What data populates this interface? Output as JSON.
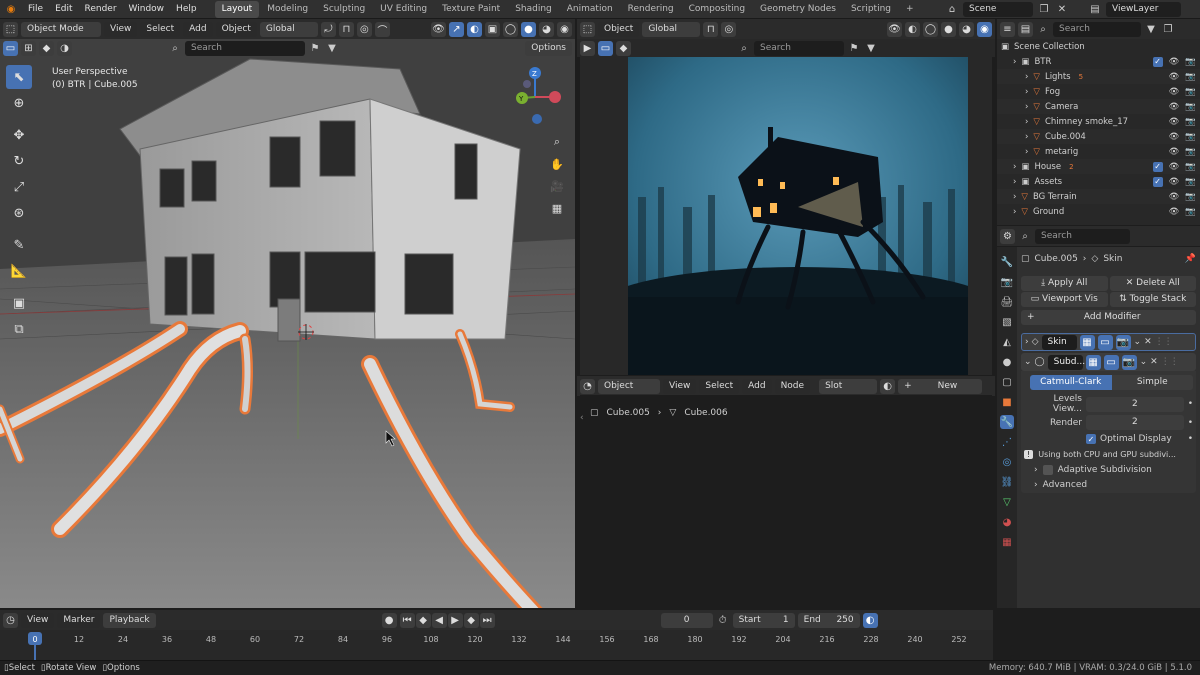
{
  "top_menu": [
    "File",
    "Edit",
    "Render",
    "Window",
    "Help"
  ],
  "workspaces": [
    "Layout",
    "Modeling",
    "Sculpting",
    "UV Editing",
    "Texture Paint",
    "Shading",
    "Animation",
    "Rendering",
    "Compositing",
    "Geometry Nodes",
    "Scripting"
  ],
  "workspace_add": "+",
  "scene": "Scene",
  "view_layer": "ViewLayer",
  "viewport": {
    "mode": "Object Mode",
    "menus": [
      "View",
      "Select",
      "Add",
      "Object"
    ],
    "orientation": "Global",
    "search_placeholder": "Search",
    "options": "Options",
    "perspective_label": "User Perspective",
    "object_info": "(0) BTR | Cube.005",
    "gizmo": {
      "z": "Z",
      "y": "Y",
      "x": "X"
    }
  },
  "render_view": {
    "header_label": "Object",
    "orientation": "Global",
    "search_placeholder": "Search"
  },
  "node_editor": {
    "type": "Object",
    "menus": [
      "View",
      "Select",
      "Add",
      "Node"
    ],
    "slot": "Slot",
    "new_label": "New",
    "breadcrumb": [
      "Cube.005",
      "Cube.006"
    ]
  },
  "outliner": {
    "search_placeholder": "Search",
    "root": "Scene Collection",
    "rows": [
      {
        "name": "BTR",
        "indent": 1,
        "collection": true
      },
      {
        "name": "Lights",
        "indent": 2,
        "badge": "5"
      },
      {
        "name": "Fog",
        "indent": 2
      },
      {
        "name": "Camera",
        "indent": 2
      },
      {
        "name": "Chimney smoke_17",
        "indent": 2
      },
      {
        "name": "Cube.004",
        "indent": 2
      },
      {
        "name": "metarig",
        "indent": 2
      },
      {
        "name": "House",
        "indent": 1,
        "collection": true,
        "badge": "2"
      },
      {
        "name": "Assets",
        "indent": 1,
        "collection": true
      },
      {
        "name": "BG Terrain",
        "indent": 1
      },
      {
        "name": "Ground",
        "indent": 1
      }
    ]
  },
  "properties": {
    "search_placeholder": "Search",
    "object": "Cube.005",
    "modifier_ctx": "Skin",
    "apply_all": "Apply All",
    "delete_all": "Delete All",
    "viewport_vis": "Viewport Vis",
    "toggle_stack": "Toggle Stack",
    "add_modifier": "Add Modifier",
    "modifiers": [
      "Skin",
      "Subd..."
    ],
    "subdiv_types": [
      "Catmull-Clark",
      "Simple"
    ],
    "levels_label": "Levels View...",
    "levels_value": "2",
    "render_label": "Render",
    "render_value": "2",
    "optimal_display": "Optimal Display",
    "info_text": "Using both CPU and GPU subdivi...",
    "adaptive": "Adaptive Subdivision",
    "advanced": "Advanced"
  },
  "timeline": {
    "menus": [
      "View",
      "Marker",
      "Playback"
    ],
    "current_frame": "0",
    "start_label": "Start",
    "start": "1",
    "end_label": "End",
    "end": "250",
    "ticks": [
      "0",
      "12",
      "24",
      "36",
      "48",
      "60",
      "72",
      "84",
      "96",
      "108",
      "120",
      "132",
      "144",
      "156",
      "168",
      "180",
      "192",
      "204",
      "216",
      "228",
      "240",
      "252"
    ]
  },
  "status": {
    "select": "Select",
    "rotate": "Rotate View",
    "options": "Options",
    "memory": "Memory: 640.7 MiB | VRAM: 0.3/24.0 GiB | 5.1.0"
  },
  "colors": {
    "accent": "#4772b3",
    "orange": "#e8793a",
    "bg": "#1d1d1d",
    "panel": "#303030"
  }
}
